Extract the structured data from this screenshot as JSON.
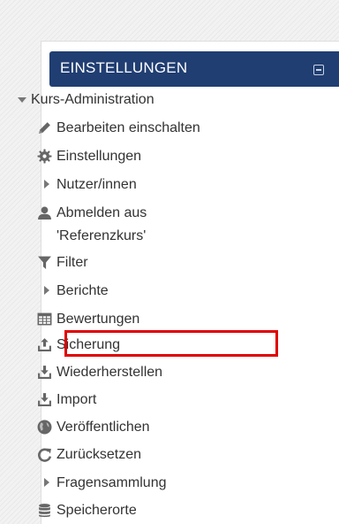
{
  "block": {
    "title": "EINSTELLUNGEN",
    "collapse_icon": "minus-square-icon"
  },
  "course_admin": {
    "label": "Kurs-Administration",
    "items": [
      {
        "label": "Bearbeiten einschalten",
        "icon": "pencil-icon"
      },
      {
        "label": "Einstellungen",
        "icon": "gear-icon"
      },
      {
        "label": "Nutzer/innen",
        "icon": "caret-right-icon"
      },
      {
        "label": "Abmelden aus",
        "label2": "'Referenzkurs'",
        "icon": "user-icon"
      },
      {
        "label": "Filter",
        "icon": "filter-icon"
      },
      {
        "label": "Berichte",
        "icon": "caret-right-icon"
      },
      {
        "label": "Bewertungen",
        "icon": "table-icon"
      },
      {
        "label": "Sicherung",
        "icon": "upload-tray-icon",
        "highlighted": true
      },
      {
        "label": "Wiederherstellen",
        "icon": "download-tray-icon"
      },
      {
        "label": "Import",
        "icon": "download-tray-icon"
      },
      {
        "label": "Veröffentlichen",
        "icon": "globe-icon"
      },
      {
        "label": "Zurücksetzen",
        "icon": "refresh-icon"
      },
      {
        "label": "Fragensammlung",
        "icon": "caret-right-icon"
      },
      {
        "label": "Speicherorte",
        "icon": "database-icon"
      }
    ]
  },
  "colors": {
    "header_bg": "#203e72",
    "highlight": "#e00000",
    "icon": "#666666"
  }
}
